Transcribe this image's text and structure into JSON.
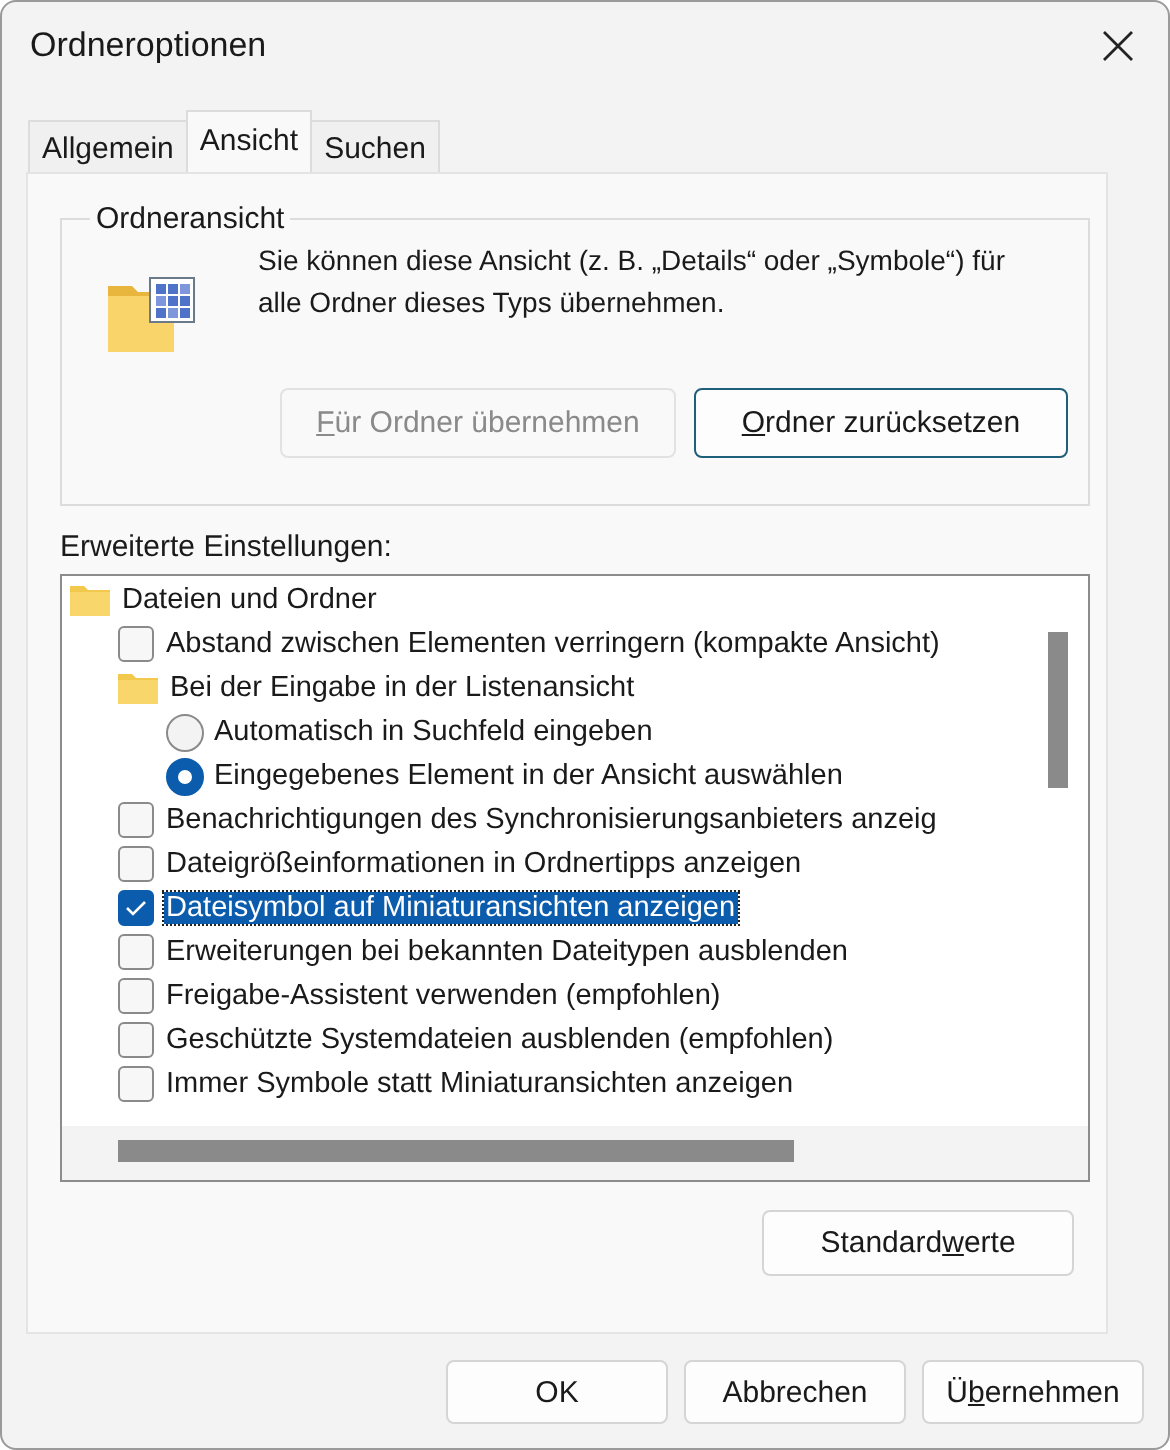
{
  "window": {
    "title": "Ordneroptionen"
  },
  "tabs": [
    {
      "label": "Allgemein",
      "selected": false
    },
    {
      "label": "Ansicht",
      "selected": true
    },
    {
      "label": "Suchen",
      "selected": false
    }
  ],
  "folder_view": {
    "title": "Ordneransicht",
    "description": "Sie können diese Ansicht (z. B. „Details“ oder „Symbole“) für alle Ordner dieses Typs übernehmen.",
    "buttons": [
      {
        "mnemonic": "F",
        "label_end": "ür Ordner übernehmen",
        "disabled": true
      },
      {
        "mnemonic": "O",
        "label_end": "rdner zurücksetzen",
        "disabled": false
      }
    ]
  },
  "advanced": {
    "title": "Erweiterte Einstellungen:",
    "items": [
      {
        "kind": "folder",
        "label": "Dateien und Ordner",
        "selected": false,
        "children": [
          {
            "kind": "checkbox",
            "label": "Abstand zwischen Elementen verringern (kompakte Ansicht)",
            "checked": false,
            "selected": false
          },
          {
            "kind": "folder",
            "label": "Bei der Eingabe in der Listenansicht",
            "selected": false,
            "children": [
              {
                "kind": "radio",
                "label": "Automatisch in Suchfeld eingeben",
                "checked": false,
                "selected": false
              },
              {
                "kind": "radio",
                "label": "Eingegebenes Element in der Ansicht auswählen",
                "checked": true,
                "selected": false
              }
            ]
          },
          {
            "kind": "checkbox",
            "label": "Benachrichtigungen des Synchronisierungsanbieters anzeig",
            "checked": false,
            "selected": false
          },
          {
            "kind": "checkbox",
            "label": "Dateigrößeinformationen in Ordnertipps anzeigen",
            "checked": false,
            "selected": false
          },
          {
            "kind": "checkbox",
            "label": "Dateisymbol auf Miniaturansichten anzeigen",
            "checked": true,
            "selected": true
          },
          {
            "kind": "checkbox",
            "label": "Erweiterungen bei bekannten Dateitypen ausblenden",
            "checked": false,
            "selected": false
          },
          {
            "kind": "checkbox",
            "label": "Freigabe-Assistent verwenden (empfohlen)",
            "checked": false,
            "selected": false
          },
          {
            "kind": "checkbox",
            "label": "Geschützte Systemdateien ausblenden (empfohlen)",
            "checked": false,
            "selected": false
          },
          {
            "kind": "checkbox",
            "label": "Immer Symbole statt Miniaturansichten anzeigen",
            "checked": false,
            "selected": false
          }
        ]
      }
    ],
    "defaults_button": {
      "label_start": "Standard",
      "mnemonic": "w",
      "label_end": "erte"
    }
  },
  "buttons": [
    {
      "label_start": "OK"
    },
    {
      "label_start": "Abbrechen"
    },
    {
      "label_start": "Ü",
      "mnemonic": "b",
      "label_end": "ernehmen"
    }
  ]
}
